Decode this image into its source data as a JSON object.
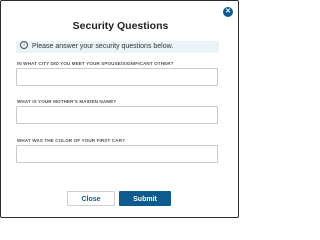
{
  "dialog": {
    "title": "Security Questions",
    "close_icon": "close-x-icon",
    "info_icon": "info-circle-icon",
    "info_text": "Please answer your security questions below.",
    "accent_color": "#0d5a8f"
  },
  "questions": [
    {
      "label": "IN WHAT CITY DID YOU MEET YOUR SPOUSE/SIGNIFICANT OTHER?",
      "value": "",
      "placeholder": ""
    },
    {
      "label": "WHAT IS YOUR MOTHER'S MAIDEN NAME?",
      "value": "",
      "placeholder": ""
    },
    {
      "label": "WHAT WAS THE COLOR OF YOUR FIRST CAR?",
      "value": "",
      "placeholder": ""
    }
  ],
  "buttons": {
    "close_label": "Close",
    "submit_label": "Submit"
  }
}
